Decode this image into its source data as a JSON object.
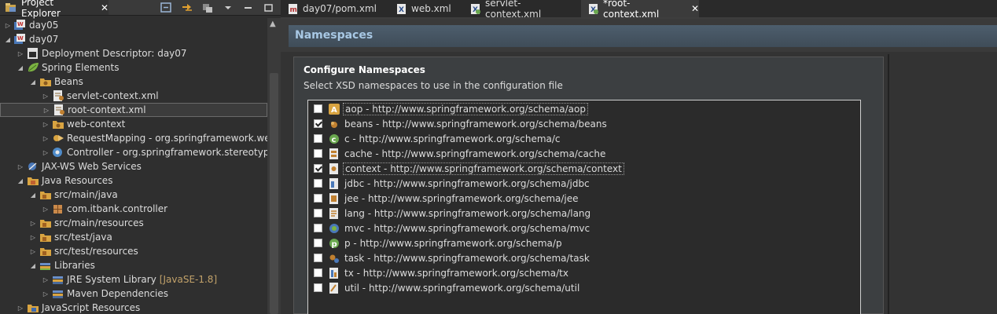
{
  "explorer": {
    "title": "Project Explorer",
    "close": "✕",
    "tree": [
      {
        "label": "day05",
        "twisty": "▷",
        "indent": 0,
        "icon": "project-icon"
      },
      {
        "label": "day07",
        "twisty": "◢",
        "indent": 0,
        "icon": "project-icon"
      },
      {
        "label": "Deployment Descriptor: day07",
        "twisty": "▷",
        "indent": 1,
        "icon": "deployment-descriptor-icon"
      },
      {
        "label": "Spring Elements",
        "twisty": "◢",
        "indent": 1,
        "icon": "spring-leaf-icon"
      },
      {
        "label": "Beans",
        "twisty": "◢",
        "indent": 2,
        "icon": "beans-folder-icon"
      },
      {
        "label": "servlet-context.xml",
        "twisty": "▷",
        "indent": 3,
        "icon": "spring-xml-icon"
      },
      {
        "label": "root-context.xml",
        "twisty": "▷",
        "indent": 3,
        "icon": "spring-xml-icon",
        "selected": true
      },
      {
        "label": "web-context",
        "twisty": "▷",
        "indent": 3,
        "icon": "beans-folder-icon"
      },
      {
        "label": "RequestMapping - org.springframework.web.b",
        "twisty": "▷",
        "indent": 3,
        "icon": "request-mapping-icon"
      },
      {
        "label": "Controller - org.springframework.stereotype",
        "twisty": "▷",
        "indent": 3,
        "icon": "controller-icon"
      },
      {
        "label": "JAX-WS Web Services",
        "twisty": "▷",
        "indent": 1,
        "icon": "web-services-icon"
      },
      {
        "label": "Java Resources",
        "twisty": "◢",
        "indent": 1,
        "icon": "java-resources-icon"
      },
      {
        "label": "src/main/java",
        "twisty": "◢",
        "indent": 2,
        "icon": "source-folder-icon"
      },
      {
        "label": "com.itbank.controller",
        "twisty": "▷",
        "indent": 3,
        "icon": "package-icon"
      },
      {
        "label": "src/main/resources",
        "twisty": "▷",
        "indent": 2,
        "icon": "source-folder-icon"
      },
      {
        "label": "src/test/java",
        "twisty": "▷",
        "indent": 2,
        "icon": "source-folder-icon"
      },
      {
        "label": "src/test/resources",
        "twisty": "▷",
        "indent": 2,
        "icon": "source-folder-icon"
      },
      {
        "label": "Libraries",
        "twisty": "◢",
        "indent": 2,
        "icon": "libraries-icon"
      },
      {
        "label": "JRE System Library",
        "decoration": "[JavaSE-1.8]",
        "twisty": "▷",
        "indent": 3,
        "icon": "library-icon"
      },
      {
        "label": "Maven Dependencies",
        "twisty": "▷",
        "indent": 3,
        "icon": "library-icon"
      },
      {
        "label": "JavaScript Resources",
        "twisty": "▷",
        "indent": 1,
        "icon": "javascript-resources-icon"
      }
    ]
  },
  "editor": {
    "tabs": [
      {
        "label": "day07/pom.xml",
        "icon": "maven-pom-icon"
      },
      {
        "label": "web.xml",
        "icon": "xml-file-icon"
      },
      {
        "label": "servlet-context.xml",
        "icon": "spring-xml-icon"
      },
      {
        "label": "*root-context.xml",
        "icon": "spring-xml-icon",
        "active": true,
        "close": "✕"
      }
    ],
    "section_title": "Namespaces",
    "panel_title": "Configure Namespaces",
    "panel_description": "Select XSD namespaces to use in the configuration file",
    "namespaces": [
      {
        "label": "aop - http://www.springframework.org/schema/aop",
        "checked": false,
        "focused": true,
        "icon": "aop-icon"
      },
      {
        "label": "beans - http://www.springframework.org/schema/beans",
        "checked": true,
        "icon": "beans-icon"
      },
      {
        "label": "c - http://www.springframework.org/schema/c",
        "checked": false,
        "icon": "c-namespace-icon"
      },
      {
        "label": "cache - http://www.springframework.org/schema/cache",
        "checked": false,
        "icon": "cache-icon"
      },
      {
        "label": "context - http://www.springframework.org/schema/context",
        "checked": true,
        "focused": true,
        "icon": "context-icon"
      },
      {
        "label": "jdbc - http://www.springframework.org/schema/jdbc",
        "checked": false,
        "icon": "jdbc-icon"
      },
      {
        "label": "jee - http://www.springframework.org/schema/jee",
        "checked": false,
        "icon": "jee-icon"
      },
      {
        "label": "lang - http://www.springframework.org/schema/lang",
        "checked": false,
        "icon": "lang-icon"
      },
      {
        "label": "mvc - http://www.springframework.org/schema/mvc",
        "checked": false,
        "icon": "mvc-icon"
      },
      {
        "label": "p - http://www.springframework.org/schema/p",
        "checked": false,
        "icon": "p-namespace-icon"
      },
      {
        "label": "task - http://www.springframework.org/schema/task",
        "checked": false,
        "icon": "task-icon"
      },
      {
        "label": "tx - http://www.springframework.org/schema/tx",
        "checked": false,
        "icon": "tx-icon"
      },
      {
        "label": "util - http://www.springframework.org/schema/util",
        "checked": false,
        "icon": "util-icon"
      }
    ]
  }
}
